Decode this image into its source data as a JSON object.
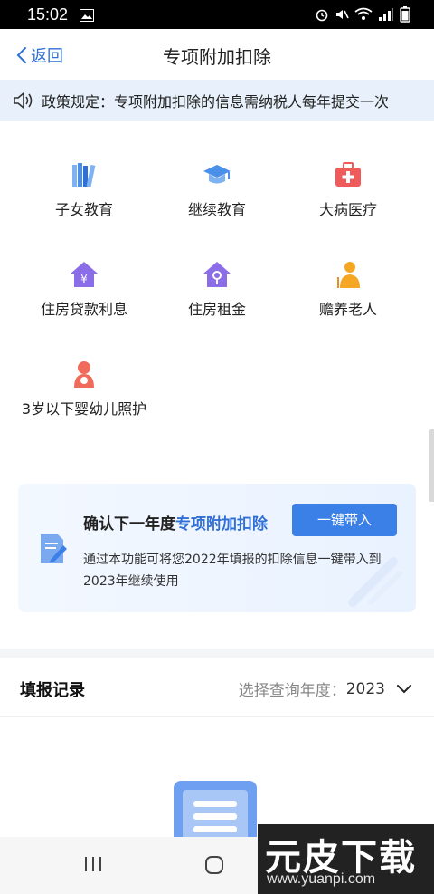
{
  "status_bar": {
    "time": "15:02"
  },
  "nav": {
    "back_label": "返回",
    "title": "专项附加扣除"
  },
  "policy": {
    "text": "政策规定：专项附加扣除的信息需纳税人每年提交一次"
  },
  "categories": [
    {
      "label": "子女教育",
      "icon": "books-icon",
      "color": "#4a8fe8"
    },
    {
      "label": "继续教育",
      "icon": "graduation-cap-icon",
      "color": "#4a8fe8"
    },
    {
      "label": "大病医疗",
      "icon": "first-aid-kit-icon",
      "color": "#ef5b5b"
    },
    {
      "label": "住房贷款利息",
      "icon": "house-yen-icon",
      "color": "#8b6de8"
    },
    {
      "label": "住房租金",
      "icon": "house-key-icon",
      "color": "#8b6de8"
    },
    {
      "label": "赡养老人",
      "icon": "elderly-icon",
      "color": "#f5a623"
    },
    {
      "label": "3岁以下婴幼儿照护",
      "icon": "mother-baby-icon",
      "color": "#ef6b5b"
    }
  ],
  "confirm_card": {
    "title_prefix": "确认下一年度",
    "title_highlight": "专项附加扣除",
    "button_label": "一键带入",
    "description": "通过本功能可将您2022年填报的扣除信息一键带入到2023年继续使用"
  },
  "records": {
    "title": "填报记录",
    "year_label": "选择查询年度：",
    "year_value": "2023"
  },
  "watermark": {
    "logo": "元皮下载",
    "url": "www.yuanpi.com"
  },
  "colors": {
    "accent": "#2f6fd6",
    "button": "#3b80e6",
    "banner_bg": "#e8f1fb"
  }
}
